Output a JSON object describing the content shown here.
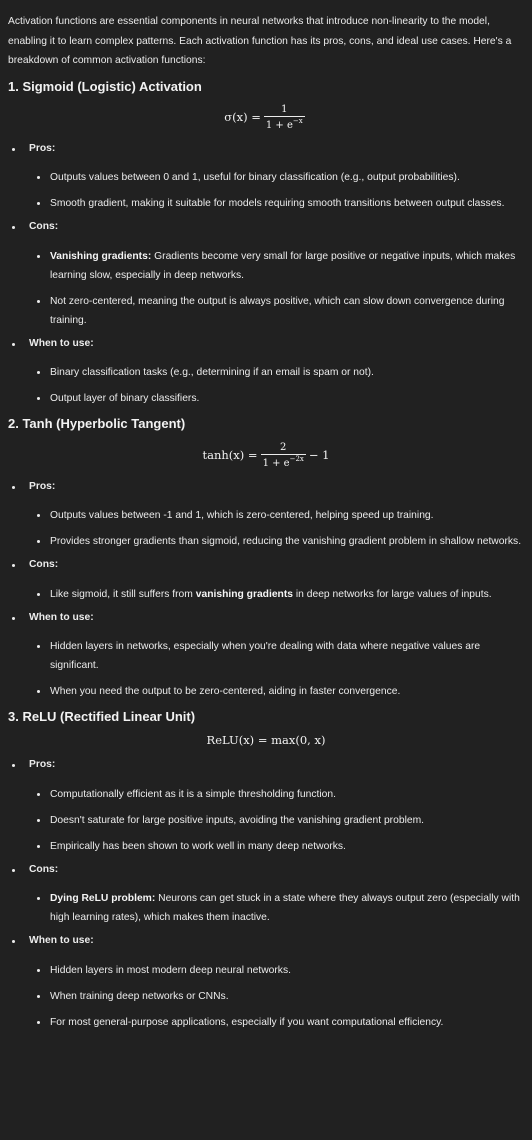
{
  "intro": "Activation functions are essential components in neural networks that introduce non-linearity to the model, enabling it to learn complex patterns. Each activation function has its pros, cons, and ideal use cases. Here's a breakdown of common activation functions:",
  "sections": [
    {
      "heading": "1. Sigmoid (Logistic) Activation",
      "formula": {
        "lhs": "σ(x) =",
        "num": "1",
        "den_base": "1 + e",
        "den_sup": "−x",
        "tail": ""
      },
      "pros_label": "Pros:",
      "pros": [
        {
          "bold": "",
          "text": "Outputs values between 0 and 1, useful for binary classification (e.g., output probabilities)."
        },
        {
          "bold": "",
          "text": "Smooth gradient, making it suitable for models requiring smooth transitions between output classes."
        }
      ],
      "cons_label": "Cons:",
      "cons": [
        {
          "bold": "Vanishing gradients:",
          "text": " Gradients become very small for large positive or negative inputs, which makes learning slow, especially in deep networks."
        },
        {
          "bold": "",
          "text": "Not zero-centered, meaning the output is always positive, which can slow down convergence during training."
        }
      ],
      "use_label": "When to use:",
      "use": [
        {
          "bold": "",
          "text": "Binary classification tasks (e.g., determining if an email is spam or not)."
        },
        {
          "bold": "",
          "text": "Output layer of binary classifiers."
        }
      ]
    },
    {
      "heading": "2. Tanh (Hyperbolic Tangent)",
      "formula": {
        "lhs": "tanh(x) =",
        "num": "2",
        "den_base": "1 + e",
        "den_sup": "−2x",
        "tail": "− 1"
      },
      "pros_label": "Pros:",
      "pros": [
        {
          "bold": "",
          "text": "Outputs values between -1 and 1, which is zero-centered, helping speed up training."
        },
        {
          "bold": "",
          "text": "Provides stronger gradients than sigmoid, reducing the vanishing gradient problem in shallow networks."
        }
      ],
      "cons_label": "Cons:",
      "cons": [
        {
          "bold": "",
          "text": "Like sigmoid, it still suffers from ",
          "bold2": "vanishing gradients",
          "text2": " in deep networks for large values of inputs."
        }
      ],
      "use_label": "When to use:",
      "use": [
        {
          "bold": "",
          "text": "Hidden layers in networks, especially when you're dealing with data where negative values are significant."
        },
        {
          "bold": "",
          "text": "When you need the output to be zero-centered, aiding in faster convergence."
        }
      ]
    },
    {
      "heading": "3. ReLU (Rectified Linear Unit)",
      "formula_inline": "ReLU(x) = max(0, x)",
      "pros_label": "Pros:",
      "pros": [
        {
          "bold": "",
          "text": "Computationally efficient as it is a simple thresholding function."
        },
        {
          "bold": "",
          "text": "Doesn't saturate for large positive inputs, avoiding the vanishing gradient problem."
        },
        {
          "bold": "",
          "text": "Empirically has been shown to work well in many deep networks."
        }
      ],
      "cons_label": "Cons:",
      "cons": [
        {
          "bold": "Dying ReLU problem:",
          "text": " Neurons can get stuck in a state where they always output zero (especially with high learning rates), which makes them inactive."
        }
      ],
      "use_label": "When to use:",
      "use": [
        {
          "bold": "",
          "text": "Hidden layers in most modern deep neural networks."
        },
        {
          "bold": "",
          "text": "When training deep networks or CNNs."
        },
        {
          "bold": "",
          "text": "For most general-purpose applications, especially if you want computational efficiency."
        }
      ]
    }
  ]
}
